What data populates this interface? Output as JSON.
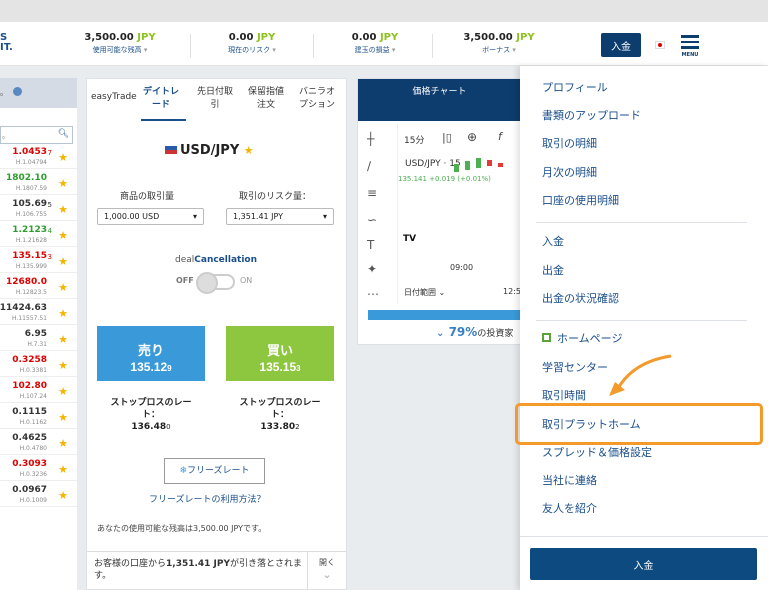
{
  "header": {
    "logo": "S\nIT.",
    "stats": [
      {
        "value": "3,500.00",
        "unit": "JPY",
        "label": "使用可能な残高"
      },
      {
        "value": "0.00",
        "unit": "JPY",
        "label": "現在のリスク"
      },
      {
        "value": "0.00",
        "unit": "JPY",
        "label": "建玉の損益"
      },
      {
        "value": "3,500.00",
        "unit": "JPY",
        "label": "ボーナス"
      }
    ],
    "deposit_label": "入金",
    "menu_label": "MENU"
  },
  "watchlist": {
    "rows": [
      {
        "price": "1.0453",
        "small": "7",
        "high": "H.1.04794",
        "color": "#e00000"
      },
      {
        "price": "1802.10",
        "small": "",
        "high": "H.1807.59",
        "color": "#2e9c2e"
      },
      {
        "price": "105.69",
        "small": "5",
        "high": "H.106.755",
        "color": "#333333"
      },
      {
        "price": "1.2123",
        "small": "4",
        "high": "H.1.21628",
        "color": "#2e9c2e"
      },
      {
        "price": "135.15",
        "small": "3",
        "high": "H.135.999",
        "color": "#e00000"
      },
      {
        "price": "12680.0",
        "small": "",
        "high": "H.12823.5",
        "color": "#e00000"
      },
      {
        "price": "11424.63",
        "small": "",
        "high": "H.11557.51",
        "color": "#333333"
      },
      {
        "price": "6.95",
        "small": "",
        "high": "H.7.31",
        "color": "#333333"
      },
      {
        "price": "0.3258",
        "small": "",
        "high": "H.0.3381",
        "color": "#e00000"
      },
      {
        "price": "102.80",
        "small": "",
        "high": "H.107.24",
        "color": "#e00000"
      },
      {
        "price": "0.1115",
        "small": "",
        "high": "H.0.1162",
        "color": "#333333"
      },
      {
        "price": "0.4625",
        "small": "",
        "high": "H.0.4780",
        "color": "#333333"
      },
      {
        "price": "0.3093",
        "small": "",
        "high": "H.0.3236",
        "color": "#e00000"
      },
      {
        "price": "0.0967",
        "small": "",
        "high": "H.0.1009",
        "color": "#333333"
      }
    ]
  },
  "trade": {
    "tabs": [
      "easyTrade",
      "デイトレ\nード",
      "先日付取\n引",
      "保留指値\n注文",
      "バニラオ\nプション"
    ],
    "pair": "USD/JPY",
    "qty_label": "商品の取引量",
    "qty_value": "1,000.00 USD",
    "risk_label": "取引のリスク量：",
    "risk_value": "1,351.41 JPY",
    "deal_prefix": "deal",
    "deal_bold": "Cancellation",
    "off": "OFF",
    "on": "ON",
    "sell_label": "売り",
    "sell_price": "135.12",
    "sell_small": "9",
    "buy_label": "買い",
    "buy_price": "135.15",
    "buy_small": "3",
    "stop_label": "ストップロスのレー\nト：",
    "stop_sell": "136.48",
    "stop_sell_small": "0",
    "stop_buy": "133.80",
    "stop_buy_small": "2",
    "freeze_btn": "フリーズレート",
    "freeze_link": "フリーズレートの利用方法？",
    "available": "あなたの使用可能な残高は3,500.00 JPYです。",
    "notice_pre": "お客様の口座から",
    "notice_amount": "1,351.41 JPY",
    "notice_post": "が引き落とされます。",
    "open_label": "開く"
  },
  "chart": {
    "title": "価格チャート",
    "timeframe": "15分",
    "symbol": "USD/JPY · 15",
    "change": "135.141 +0.019 (+0.01%)",
    "time_tick": "09:00",
    "time_tick2": "12:5",
    "date_range": "日付範囲",
    "progress_percent": 79,
    "progress_text": "79%",
    "progress_suffix": "の投資家"
  },
  "menu": {
    "group1": [
      "プロフィール",
      "書類のアップロード",
      "取引の明細",
      "月次の明細",
      "口座の使用明細"
    ],
    "group2": [
      "入金",
      "出金",
      "出金の状況確認"
    ],
    "group3": [
      "ホームページ",
      "学習センター",
      "取引時間",
      "取引プラットホーム",
      "スプレッド＆価格設定",
      "当社に連絡",
      "友人を紹介"
    ],
    "deposit_button": "入金"
  },
  "colors": {
    "accent": "#0d3c6e",
    "highlight": "#f39a2b",
    "sell": "#3a9ad9",
    "buy": "#8dc63f"
  }
}
